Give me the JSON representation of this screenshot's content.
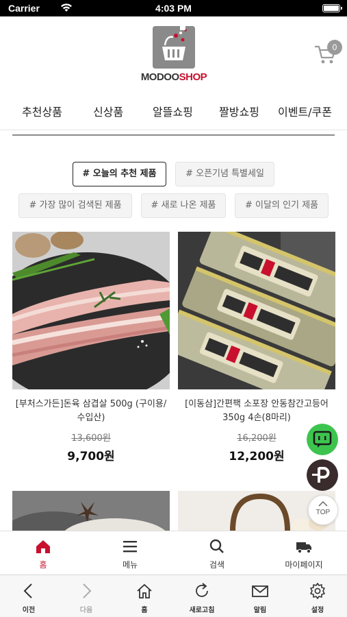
{
  "status_bar": {
    "carrier": "Carrier",
    "time": "4:03 PM"
  },
  "header": {
    "logo_part1": "MODOO",
    "logo_part2": "SHOP",
    "cart_count": "0"
  },
  "categories": [
    "추천상품",
    "신상품",
    "알뜰쇼핑",
    "짤방쇼핑",
    "이벤트/쿠폰"
  ],
  "hashtags": [
    {
      "label": "# 오늘의 추천 제품",
      "active": true
    },
    {
      "label": "# 오픈기념 특별세일",
      "active": false
    },
    {
      "label": "# 가장 많이 검색된 제품",
      "active": false
    },
    {
      "label": "# 새로 나온 제품",
      "active": false
    },
    {
      "label": "# 이달의 인기 제품",
      "active": false
    }
  ],
  "products": [
    {
      "name": "[부처스가든]돈육 삼겹살 500g (구이용/수입산)",
      "original_price": "13,600원",
      "price": "9,700원"
    },
    {
      "name": "[이동삼]간편팩 소포장 안동참간고등어 350g 4손(8마리)",
      "original_price": "16,200원",
      "price": "12,200원"
    }
  ],
  "floating": {
    "top_label": "TOP"
  },
  "tab_bar": [
    {
      "label": "홈",
      "icon": "home-icon",
      "active": true
    },
    {
      "label": "메뉴",
      "icon": "menu-icon",
      "active": false
    },
    {
      "label": "검색",
      "icon": "search-icon",
      "active": false
    },
    {
      "label": "마이페이지",
      "icon": "truck-icon",
      "active": false
    }
  ],
  "browser_bar": [
    {
      "label": "이전",
      "icon": "back-icon"
    },
    {
      "label": "다음",
      "icon": "forward-icon"
    },
    {
      "label": "홈",
      "icon": "home-outline-icon"
    },
    {
      "label": "새로고침",
      "icon": "refresh-icon"
    },
    {
      "label": "알림",
      "icon": "mail-icon"
    },
    {
      "label": "설정",
      "icon": "gear-icon"
    }
  ],
  "colors": {
    "accent": "#c8102e",
    "talk_green": "#3dc44f",
    "point_dark": "#3a2c2c"
  }
}
